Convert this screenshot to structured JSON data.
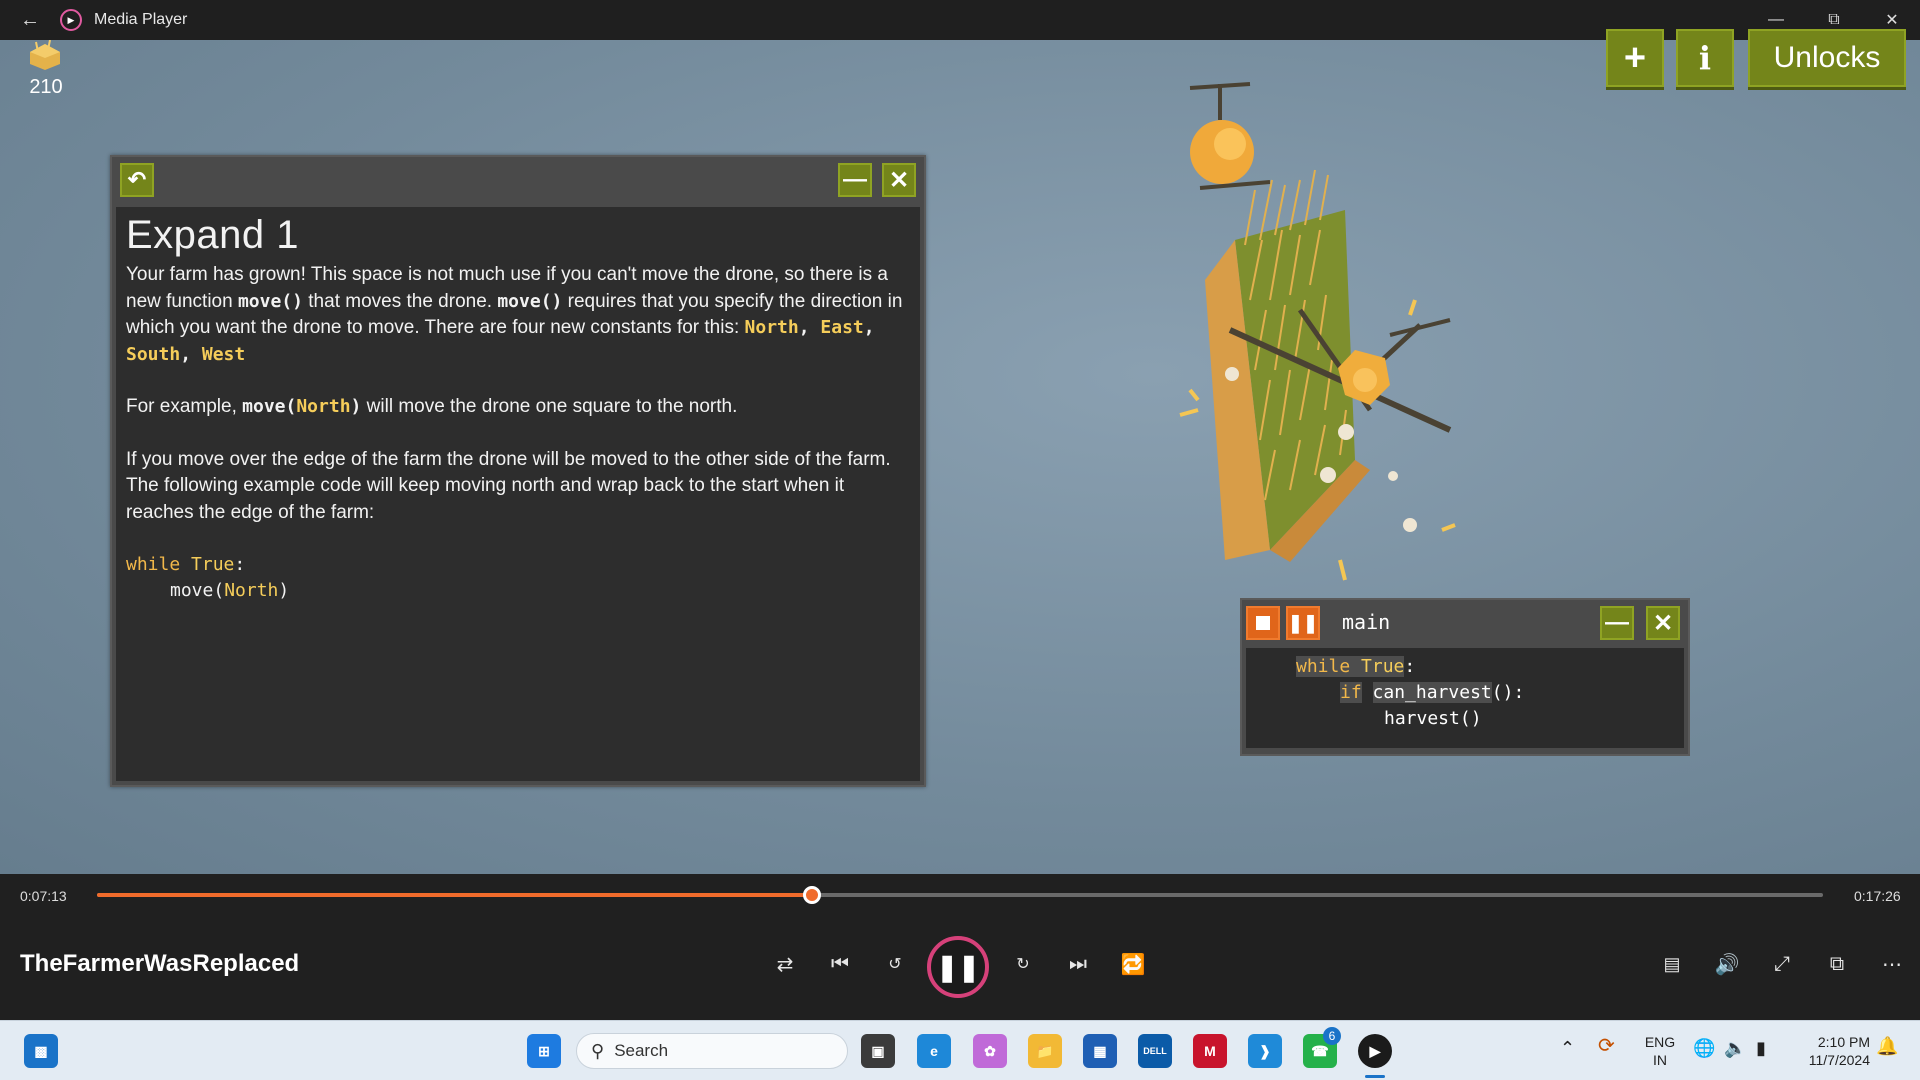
{
  "window": {
    "title": "Media Player"
  },
  "game": {
    "coin_count": "210",
    "buttons": {
      "plus": "+",
      "info": "i",
      "unlocks": "Unlocks"
    },
    "info_window": {
      "title": "Expand 1",
      "p1_a": "Your farm has grown! This space is not much use if you can't move the drone, so there is a new function ",
      "p1_b": "move()",
      "p1_c": " that moves the drone. ",
      "p1_d": "move()",
      "p1_e": " requires that you specify the direction in which you want the drone to move. There are four new constants for this: ",
      "p1_north": "North",
      "p1_east": "East",
      "p1_south": "South",
      "p1_west": "West",
      "p2_a": "For example, ",
      "p2_code": "move(",
      "p2_const": "North",
      "p2_close": ")",
      "p2_b": " will move the drone one square to the north.",
      "p3": "If you move over the edge of the farm the drone will be moved to the other side of the farm.",
      "p4": "The following example code will keep moving north and wrap back to the start when it reaches the edge of the farm:",
      "code_while": "while",
      "code_true": "True",
      "code_colon": ":",
      "code_move": "move(",
      "code_north": "North",
      "code_paren": ")"
    },
    "main_window": {
      "title": "main",
      "line1_kw": "while",
      "line1_true": "True",
      "line1_colon": ":",
      "line2_kw": "if",
      "line2_fn": "can_harvest",
      "line2_parens": "()",
      "line2_colon": ":",
      "line3": "harvest()"
    }
  },
  "player": {
    "current_time": "0:07:13",
    "total_time": "0:17:26",
    "progress_fraction": 0.414,
    "media_title": "TheFarmerWasReplaced"
  },
  "taskbar": {
    "search_placeholder": "Search",
    "whatsapp_badge": "6",
    "lang_top": "ENG",
    "lang_bottom": "IN",
    "clock_time": "2:10 PM",
    "clock_date": "11/7/2024"
  },
  "colors": {
    "accent_orange": "#f06b2b",
    "button_green": "#74851a",
    "code_const": "#f5cd5a"
  }
}
